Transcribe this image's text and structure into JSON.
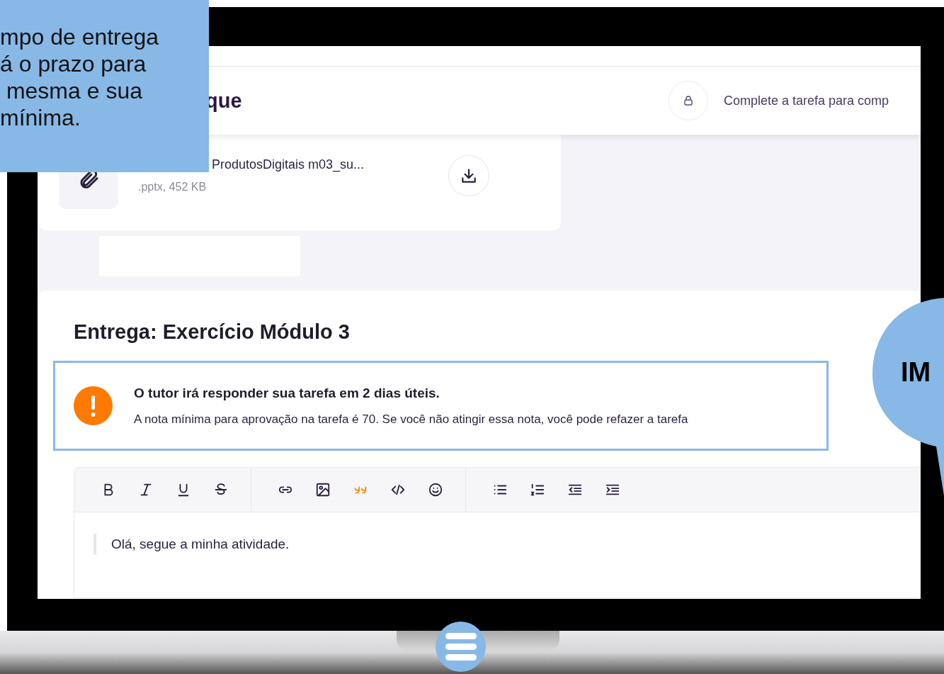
{
  "callout": {
    "text": "mpo de entrega\ná o prazo para\n mesma e sua\nmínima."
  },
  "header": {
    "title": "que",
    "lock_message": "Complete a tarefa para comp"
  },
  "attachment": {
    "name": "ProdutosDigitais m03_su...",
    "meta": ".pptx, 452 KB"
  },
  "submission": {
    "title": "Entrega: Exercício Módulo 3",
    "alert": {
      "heading": "O tutor irá responder sua tarefa em 2 dias úteis.",
      "body": "A nota mínima para aprovação na tarefa é 70. Se você não atingir essa nota, você pode refazer a tarefa"
    },
    "toolbar": [
      [
        {
          "kind": "bold"
        },
        {
          "kind": "italic"
        },
        {
          "kind": "underline"
        },
        {
          "kind": "strikethrough"
        }
      ],
      [
        {
          "kind": "link"
        },
        {
          "kind": "image"
        },
        {
          "kind": "quote"
        },
        {
          "kind": "code"
        },
        {
          "kind": "emoji"
        }
      ],
      [
        {
          "kind": "bullet-list"
        },
        {
          "kind": "numbered-list"
        },
        {
          "kind": "outdent"
        },
        {
          "kind": "indent"
        }
      ]
    ],
    "editor": {
      "value": "Olá, segue a minha atividade."
    }
  },
  "bubble": {
    "text": "IM"
  }
}
